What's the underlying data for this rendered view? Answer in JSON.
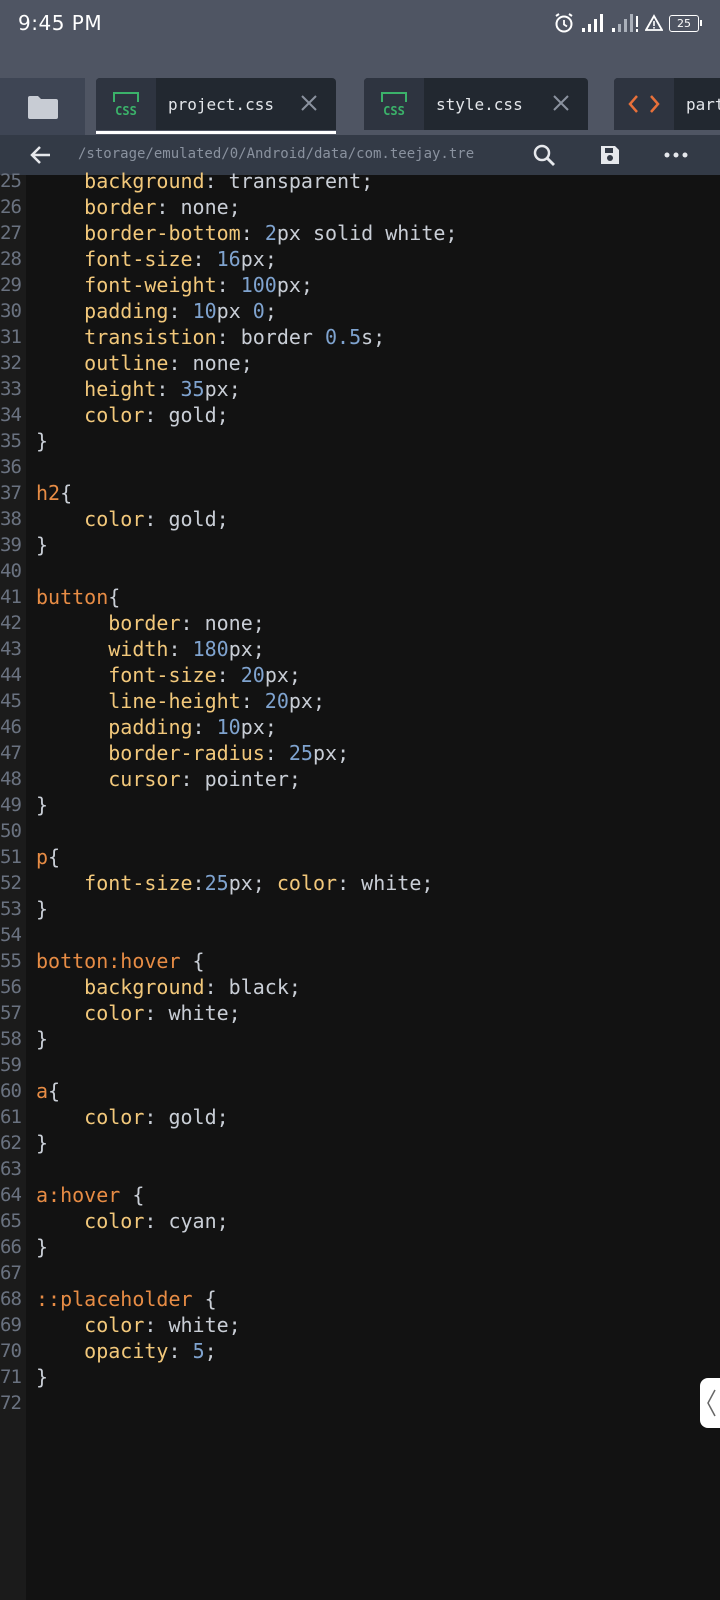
{
  "status": {
    "time": "9:45 PM",
    "battery": "25"
  },
  "tabs": [
    {
      "label": "project.css",
      "icon": "css-file-icon",
      "active": true
    },
    {
      "label": "style.css",
      "icon": "css-file-icon",
      "active": false
    },
    {
      "label": "part",
      "icon": "html-code-icon",
      "active": false
    }
  ],
  "path": "/storage/emulated/0/Android/data/com.teejay.tre",
  "colors": {
    "selector": "#e78c45",
    "property": "#f2c87b",
    "number": "#7fa3cf",
    "text": "#c9ced6",
    "css_icon": "#3bb26a"
  },
  "code_lines": [
    {
      "num": "25",
      "tokens": [
        [
          "t",
          "    "
        ],
        [
          "p",
          "background"
        ],
        [
          "t",
          ": transparent;"
        ]
      ]
    },
    {
      "num": "26",
      "tokens": [
        [
          "t",
          "    "
        ],
        [
          "p",
          "border"
        ],
        [
          "t",
          ": none;"
        ]
      ]
    },
    {
      "num": "27",
      "tokens": [
        [
          "t",
          "    "
        ],
        [
          "p",
          "border-bottom"
        ],
        [
          "t",
          ": "
        ],
        [
          "n",
          "2"
        ],
        [
          "t",
          "px solid white;"
        ]
      ]
    },
    {
      "num": "28",
      "tokens": [
        [
          "t",
          "    "
        ],
        [
          "p",
          "font-size"
        ],
        [
          "t",
          ": "
        ],
        [
          "n",
          "16"
        ],
        [
          "t",
          "px;"
        ]
      ]
    },
    {
      "num": "29",
      "tokens": [
        [
          "t",
          "    "
        ],
        [
          "p",
          "font-weight"
        ],
        [
          "t",
          ": "
        ],
        [
          "n",
          "100"
        ],
        [
          "t",
          "px;"
        ]
      ]
    },
    {
      "num": "30",
      "tokens": [
        [
          "t",
          "    "
        ],
        [
          "p",
          "padding"
        ],
        [
          "t",
          ": "
        ],
        [
          "n",
          "10"
        ],
        [
          "t",
          "px "
        ],
        [
          "n",
          "0"
        ],
        [
          "t",
          ";"
        ]
      ]
    },
    {
      "num": "31",
      "tokens": [
        [
          "t",
          "    "
        ],
        [
          "p",
          "transistion"
        ],
        [
          "t",
          ": border "
        ],
        [
          "n",
          "0.5"
        ],
        [
          "t",
          "s;"
        ]
      ]
    },
    {
      "num": "32",
      "tokens": [
        [
          "t",
          "    "
        ],
        [
          "p",
          "outline"
        ],
        [
          "t",
          ": none;"
        ]
      ]
    },
    {
      "num": "33",
      "tokens": [
        [
          "t",
          "    "
        ],
        [
          "p",
          "height"
        ],
        [
          "t",
          ": "
        ],
        [
          "n",
          "35"
        ],
        [
          "t",
          "px;"
        ]
      ]
    },
    {
      "num": "34",
      "tokens": [
        [
          "t",
          "    "
        ],
        [
          "p",
          "color"
        ],
        [
          "t",
          ": gold;"
        ]
      ]
    },
    {
      "num": "35",
      "tokens": [
        [
          "t",
          "}"
        ]
      ]
    },
    {
      "num": "36",
      "tokens": []
    },
    {
      "num": "37",
      "tokens": [
        [
          "s",
          "h2"
        ],
        [
          "t",
          "{"
        ]
      ]
    },
    {
      "num": "38",
      "tokens": [
        [
          "t",
          "    "
        ],
        [
          "p",
          "color"
        ],
        [
          "t",
          ": gold;"
        ]
      ]
    },
    {
      "num": "39",
      "tokens": [
        [
          "t",
          "}"
        ]
      ]
    },
    {
      "num": "40",
      "tokens": []
    },
    {
      "num": "41",
      "tokens": [
        [
          "s",
          "button"
        ],
        [
          "t",
          "{"
        ]
      ]
    },
    {
      "num": "42",
      "tokens": [
        [
          "t",
          "      "
        ],
        [
          "p",
          "border"
        ],
        [
          "t",
          ": none;"
        ]
      ]
    },
    {
      "num": "43",
      "tokens": [
        [
          "t",
          "      "
        ],
        [
          "p",
          "width"
        ],
        [
          "t",
          ": "
        ],
        [
          "n",
          "180"
        ],
        [
          "t",
          "px;"
        ]
      ]
    },
    {
      "num": "44",
      "tokens": [
        [
          "t",
          "      "
        ],
        [
          "p",
          "font-size"
        ],
        [
          "t",
          ": "
        ],
        [
          "n",
          "20"
        ],
        [
          "t",
          "px;"
        ]
      ]
    },
    {
      "num": "45",
      "tokens": [
        [
          "t",
          "      "
        ],
        [
          "p",
          "line-height"
        ],
        [
          "t",
          ": "
        ],
        [
          "n",
          "20"
        ],
        [
          "t",
          "px;"
        ]
      ]
    },
    {
      "num": "46",
      "tokens": [
        [
          "t",
          "      "
        ],
        [
          "p",
          "padding"
        ],
        [
          "t",
          ": "
        ],
        [
          "n",
          "10"
        ],
        [
          "t",
          "px;"
        ]
      ]
    },
    {
      "num": "47",
      "tokens": [
        [
          "t",
          "      "
        ],
        [
          "p",
          "border-radius"
        ],
        [
          "t",
          ": "
        ],
        [
          "n",
          "25"
        ],
        [
          "t",
          "px;"
        ]
      ]
    },
    {
      "num": "48",
      "tokens": [
        [
          "t",
          "      "
        ],
        [
          "p",
          "cursor"
        ],
        [
          "t",
          ": pointer;"
        ]
      ]
    },
    {
      "num": "49",
      "tokens": [
        [
          "t",
          "}"
        ]
      ]
    },
    {
      "num": "50",
      "tokens": []
    },
    {
      "num": "51",
      "tokens": [
        [
          "s",
          "p"
        ],
        [
          "t",
          "{"
        ]
      ]
    },
    {
      "num": "52",
      "tokens": [
        [
          "t",
          "    "
        ],
        [
          "p",
          "font-size"
        ],
        [
          "t",
          ":"
        ],
        [
          "n",
          "25"
        ],
        [
          "t",
          "px; "
        ],
        [
          "p",
          "color"
        ],
        [
          "t",
          ": white;"
        ]
      ]
    },
    {
      "num": "53",
      "tokens": [
        [
          "t",
          "}"
        ]
      ]
    },
    {
      "num": "54",
      "tokens": []
    },
    {
      "num": "55",
      "tokens": [
        [
          "s",
          "botton:hover"
        ],
        [
          "t",
          " {"
        ]
      ]
    },
    {
      "num": "56",
      "tokens": [
        [
          "t",
          "    "
        ],
        [
          "p",
          "background"
        ],
        [
          "t",
          ": black;"
        ]
      ]
    },
    {
      "num": "57",
      "tokens": [
        [
          "t",
          "    "
        ],
        [
          "p",
          "color"
        ],
        [
          "t",
          ": white;"
        ]
      ]
    },
    {
      "num": "58",
      "tokens": [
        [
          "t",
          "}"
        ]
      ]
    },
    {
      "num": "59",
      "tokens": []
    },
    {
      "num": "60",
      "tokens": [
        [
          "s",
          "a"
        ],
        [
          "t",
          "{"
        ]
      ]
    },
    {
      "num": "61",
      "tokens": [
        [
          "t",
          "    "
        ],
        [
          "p",
          "color"
        ],
        [
          "t",
          ": gold;"
        ]
      ]
    },
    {
      "num": "62",
      "tokens": [
        [
          "t",
          "}"
        ]
      ]
    },
    {
      "num": "63",
      "tokens": []
    },
    {
      "num": "64",
      "tokens": [
        [
          "s",
          "a:hover"
        ],
        [
          "t",
          " {"
        ]
      ]
    },
    {
      "num": "65",
      "tokens": [
        [
          "t",
          "    "
        ],
        [
          "p",
          "color"
        ],
        [
          "t",
          ": cyan;"
        ]
      ]
    },
    {
      "num": "66",
      "tokens": [
        [
          "t",
          "}"
        ]
      ]
    },
    {
      "num": "67",
      "tokens": []
    },
    {
      "num": "68",
      "tokens": [
        [
          "s",
          "::placeholder"
        ],
        [
          "t",
          " {"
        ]
      ]
    },
    {
      "num": "69",
      "tokens": [
        [
          "t",
          "    "
        ],
        [
          "p",
          "color"
        ],
        [
          "t",
          ": white;"
        ]
      ]
    },
    {
      "num": "70",
      "tokens": [
        [
          "t",
          "    "
        ],
        [
          "p",
          "opacity"
        ],
        [
          "t",
          ": "
        ],
        [
          "n",
          "5"
        ],
        [
          "t",
          ";"
        ]
      ]
    },
    {
      "num": "71",
      "tokens": [
        [
          "t",
          "}"
        ]
      ]
    },
    {
      "num": "72",
      "tokens": []
    }
  ]
}
